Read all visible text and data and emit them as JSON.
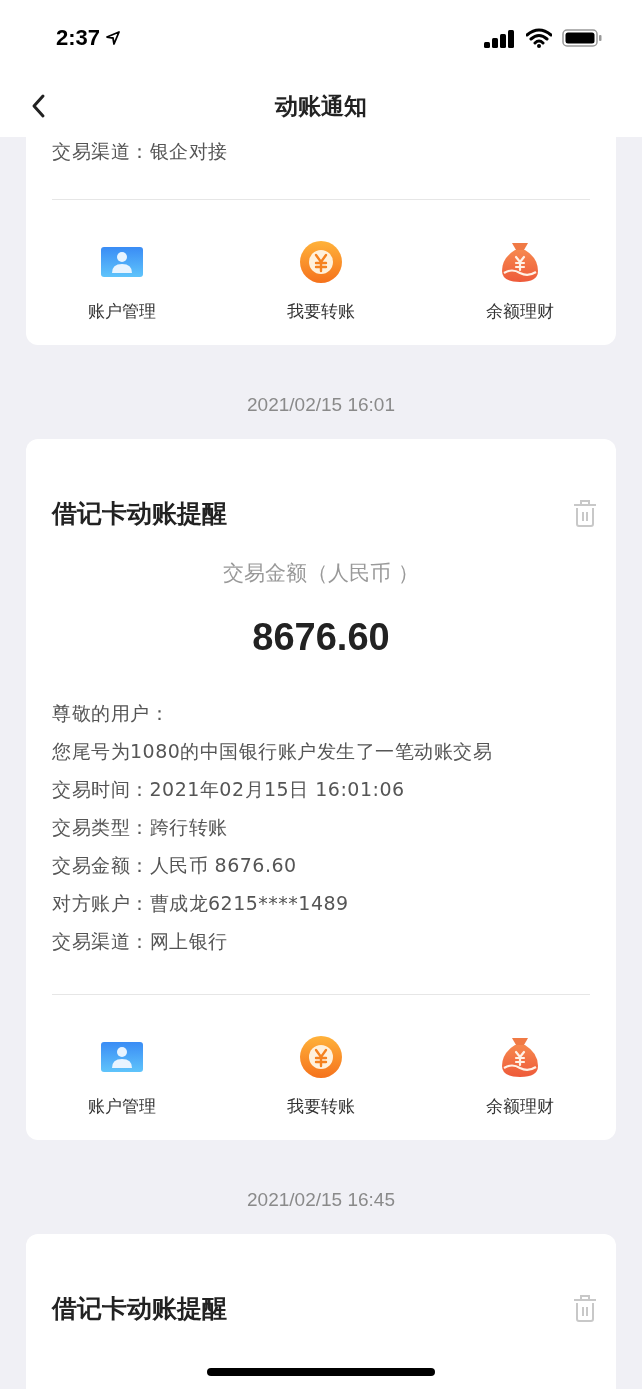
{
  "status_bar": {
    "time": "2:37"
  },
  "nav": {
    "title": "动账通知"
  },
  "notifications": [
    {
      "details": [
        "交易渠道：银企对接"
      ],
      "actions": [
        {
          "kind": "account",
          "label": "账户管理"
        },
        {
          "kind": "transfer",
          "label": "我要转账"
        },
        {
          "kind": "wealth",
          "label": "余额理财"
        }
      ]
    },
    {
      "time": "2021/02/15 16:01",
      "title": "借记卡动账提醒",
      "amount_label": "交易金额（人民币 ）",
      "amount": "8676.60",
      "details": [
        "尊敬的用户：",
        "您尾号为1080的中国银行账户发生了一笔动账交易",
        "交易时间：2021年02月15日 16:01:06",
        "交易类型：跨行转账",
        "交易金额：人民币 8676.60",
        "对方账户：曹成龙6215****1489",
        "交易渠道：网上银行"
      ],
      "actions": [
        {
          "kind": "account",
          "label": "账户管理"
        },
        {
          "kind": "transfer",
          "label": "我要转账"
        },
        {
          "kind": "wealth",
          "label": "余额理财"
        }
      ]
    },
    {
      "time": "2021/02/15 16:45",
      "title": "借记卡动账提醒"
    }
  ]
}
